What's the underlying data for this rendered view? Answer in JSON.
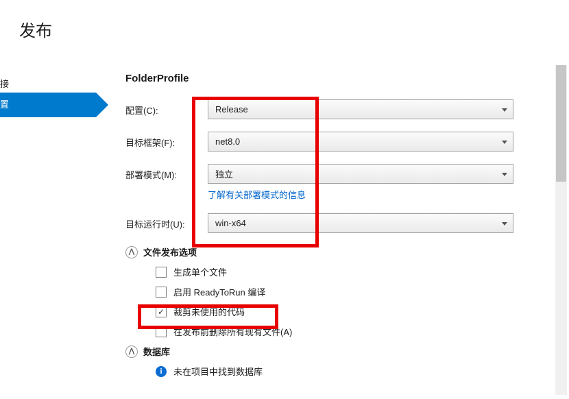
{
  "title": "发布",
  "sidebar": {
    "items": [
      {
        "label": "接"
      },
      {
        "label": "置"
      }
    ],
    "active_index": 1
  },
  "profile_title": "FolderProfile",
  "form": {
    "configuration": {
      "label": "配置(C):",
      "value": "Release"
    },
    "target_framework": {
      "label": "目标框架(F):",
      "value": "net8.0"
    },
    "deploy_mode": {
      "label": "部署模式(M):",
      "value": "独立",
      "link": "了解有关部署模式的信息"
    },
    "target_runtime": {
      "label": "目标运行时(U):",
      "value": "win-x64"
    }
  },
  "file_publish_options": {
    "header": "文件发布选项",
    "items": [
      {
        "label": "生成单个文件",
        "checked": false
      },
      {
        "label": "启用 ReadyToRun 编译",
        "checked": false
      },
      {
        "label": "裁剪未使用的代码",
        "checked": true
      },
      {
        "label": "在发布前删除所有现有文件(A)",
        "checked": false
      }
    ]
  },
  "database": {
    "header": "数据库",
    "info_text": "未在项目中找到数据库"
  }
}
